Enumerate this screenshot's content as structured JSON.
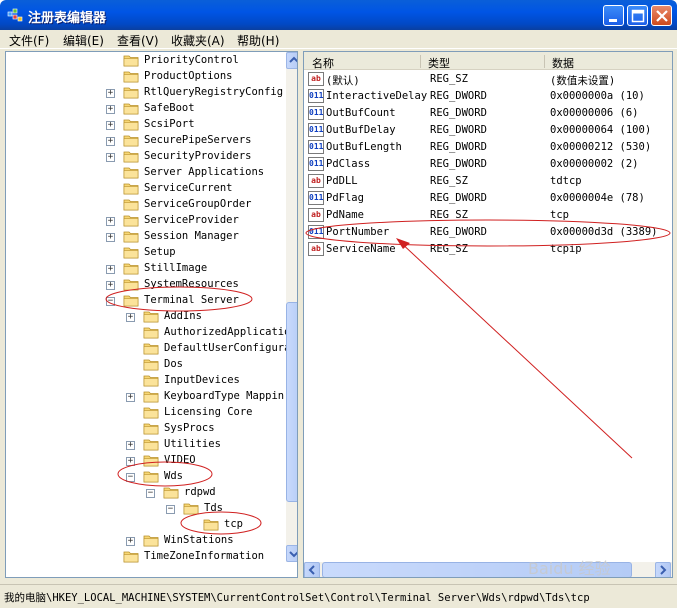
{
  "window": {
    "title": "注册表编辑器"
  },
  "menu": [
    "文件(F)",
    "编辑(E)",
    "查看(V)",
    "收藏夹(A)",
    "帮助(H)"
  ],
  "tree": [
    {
      "label": "PriorityControl",
      "indent": 0,
      "expander": ""
    },
    {
      "label": "ProductOptions",
      "indent": 0,
      "expander": ""
    },
    {
      "label": "RtlQueryRegistryConfig",
      "indent": 0,
      "expander": "+"
    },
    {
      "label": "SafeBoot",
      "indent": 0,
      "expander": "+"
    },
    {
      "label": "ScsiPort",
      "indent": 0,
      "expander": "+"
    },
    {
      "label": "SecurePipeServers",
      "indent": 0,
      "expander": "+"
    },
    {
      "label": "SecurityProviders",
      "indent": 0,
      "expander": "+"
    },
    {
      "label": "Server Applications",
      "indent": 0,
      "expander": ""
    },
    {
      "label": "ServiceCurrent",
      "indent": 0,
      "expander": ""
    },
    {
      "label": "ServiceGroupOrder",
      "indent": 0,
      "expander": ""
    },
    {
      "label": "ServiceProvider",
      "indent": 0,
      "expander": "+"
    },
    {
      "label": "Session Manager",
      "indent": 0,
      "expander": "+"
    },
    {
      "label": "Setup",
      "indent": 0,
      "expander": ""
    },
    {
      "label": "StillImage",
      "indent": 0,
      "expander": "+"
    },
    {
      "label": "SystemResources",
      "indent": 0,
      "expander": "+"
    },
    {
      "label": "Terminal Server",
      "indent": 0,
      "expander": "-"
    },
    {
      "label": "AddIns",
      "indent": 1,
      "expander": "+"
    },
    {
      "label": "AuthorizedApplicatio",
      "indent": 1,
      "expander": ""
    },
    {
      "label": "DefaultUserConfigura",
      "indent": 1,
      "expander": ""
    },
    {
      "label": "Dos",
      "indent": 1,
      "expander": ""
    },
    {
      "label": "InputDevices",
      "indent": 1,
      "expander": ""
    },
    {
      "label": "KeyboardType Mappin",
      "indent": 1,
      "expander": "+"
    },
    {
      "label": "Licensing Core",
      "indent": 1,
      "expander": ""
    },
    {
      "label": "SysProcs",
      "indent": 1,
      "expander": ""
    },
    {
      "label": "Utilities",
      "indent": 1,
      "expander": "+"
    },
    {
      "label": "VIDEO",
      "indent": 1,
      "expander": "+"
    },
    {
      "label": "Wds",
      "indent": 1,
      "expander": "-"
    },
    {
      "label": "rdpwd",
      "indent": 2,
      "expander": "-"
    },
    {
      "label": "Tds",
      "indent": 3,
      "expander": "-"
    },
    {
      "label": "tcp",
      "indent": 4,
      "expander": ""
    },
    {
      "label": "WinStations",
      "indent": 1,
      "expander": "+"
    },
    {
      "label": "TimeZoneInformation",
      "indent": 0,
      "expander": ""
    }
  ],
  "list": {
    "headers": [
      "名称",
      "类型",
      "数据"
    ],
    "rows": [
      {
        "name": "(默认)",
        "type": "REG_SZ",
        "data": "(数值未设置)",
        "kind": "sz"
      },
      {
        "name": "InteractiveDelay",
        "type": "REG_DWORD",
        "data": "0x0000000a (10)",
        "kind": "dw"
      },
      {
        "name": "OutBufCount",
        "type": "REG_DWORD",
        "data": "0x00000006 (6)",
        "kind": "dw"
      },
      {
        "name": "OutBufDelay",
        "type": "REG_DWORD",
        "data": "0x00000064 (100)",
        "kind": "dw"
      },
      {
        "name": "OutBufLength",
        "type": "REG_DWORD",
        "data": "0x00000212 (530)",
        "kind": "dw"
      },
      {
        "name": "PdClass",
        "type": "REG_DWORD",
        "data": "0x00000002 (2)",
        "kind": "dw"
      },
      {
        "name": "PdDLL",
        "type": "REG_SZ",
        "data": "tdtcp",
        "kind": "sz"
      },
      {
        "name": "PdFlag",
        "type": "REG_DWORD",
        "data": "0x0000004e (78)",
        "kind": "dw"
      },
      {
        "name": "PdName",
        "type": "REG_SZ",
        "data": "tcp",
        "kind": "sz"
      },
      {
        "name": "PortNumber",
        "type": "REG_DWORD",
        "data": "0x00000d3d (3389)",
        "kind": "dw"
      },
      {
        "name": "ServiceName",
        "type": "REG_SZ",
        "data": "tcpip",
        "kind": "sz"
      }
    ]
  },
  "status": "我的电脑\\HKEY_LOCAL_MACHINE\\SYSTEM\\CurrentControlSet\\Control\\Terminal Server\\Wds\\rdpwd\\Tds\\tcp",
  "watermark": "Baidu 经验",
  "colors": {
    "titlebar": "#0055e5",
    "annotation": "#d02020"
  }
}
